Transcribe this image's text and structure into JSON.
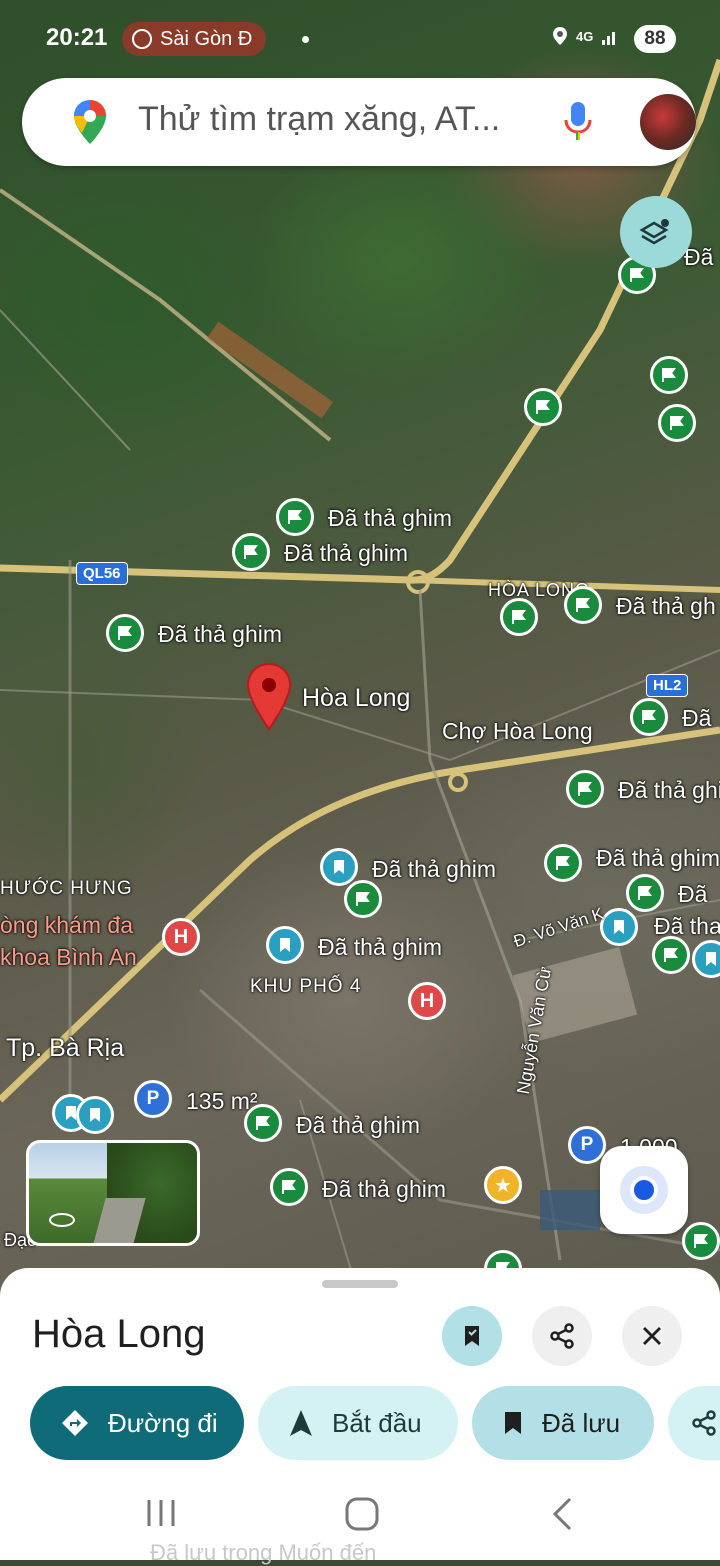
{
  "status_bar": {
    "time": "20:21",
    "notification": "Sài Gòn Đ",
    "network": "4G",
    "battery": "88"
  },
  "search": {
    "placeholder": "Thử tìm trạm xăng, AT..."
  },
  "map": {
    "selected_place": "Hòa Long",
    "road_badges": [
      "QL56",
      "HL2"
    ],
    "place_labels": {
      "hoa_long_area": "HÒA LONG",
      "market": "Chợ Hòa Long",
      "phuoc_hung": "HƯỚC HƯNG",
      "clinic_line1": "òng khám đa",
      "clinic_line2": "khoa Bình An",
      "khu_pho_4": "KHU PHỐ 4",
      "ba_ria": "Tp. Bà Rịa",
      "street_vo_van": "Đ. Võ Văn K",
      "street_nguyen_van_cu": "Nguyễn Văn Cừ",
      "dao": "Đạo",
      "area_135": "135 m²",
      "area_1000": "1.000"
    },
    "saved_pin_label": "Đã thả ghim",
    "saved_pin_label_short": "Đã",
    "saved_pin_label_tha": "Đã tha",
    "saved_pin_label_gh": "Đã thả gh"
  },
  "place_sheet": {
    "title": "Hòa Long",
    "actions": {
      "directions": "Đường đi",
      "start": "Bắt đầu",
      "saved": "Đã lưu"
    },
    "peek_text": "Đã lưu trong Muốn đến"
  },
  "icons": {
    "maps_logo": "google-maps-logo",
    "mic": "mic-icon",
    "layers": "layers-icon",
    "bookmark": "bookmark-icon",
    "share": "share-icon",
    "close": "close-icon",
    "directions": "directions-icon",
    "navigate": "navigation-arrow-icon",
    "my_location": "my-location-icon"
  },
  "colors": {
    "primary_teal": "#0f6b78",
    "chip_light": "#d4f1f4",
    "saved_chip": "#b3e0e6",
    "pin_green": "#1a8a3c",
    "pin_red": "#e53935"
  }
}
